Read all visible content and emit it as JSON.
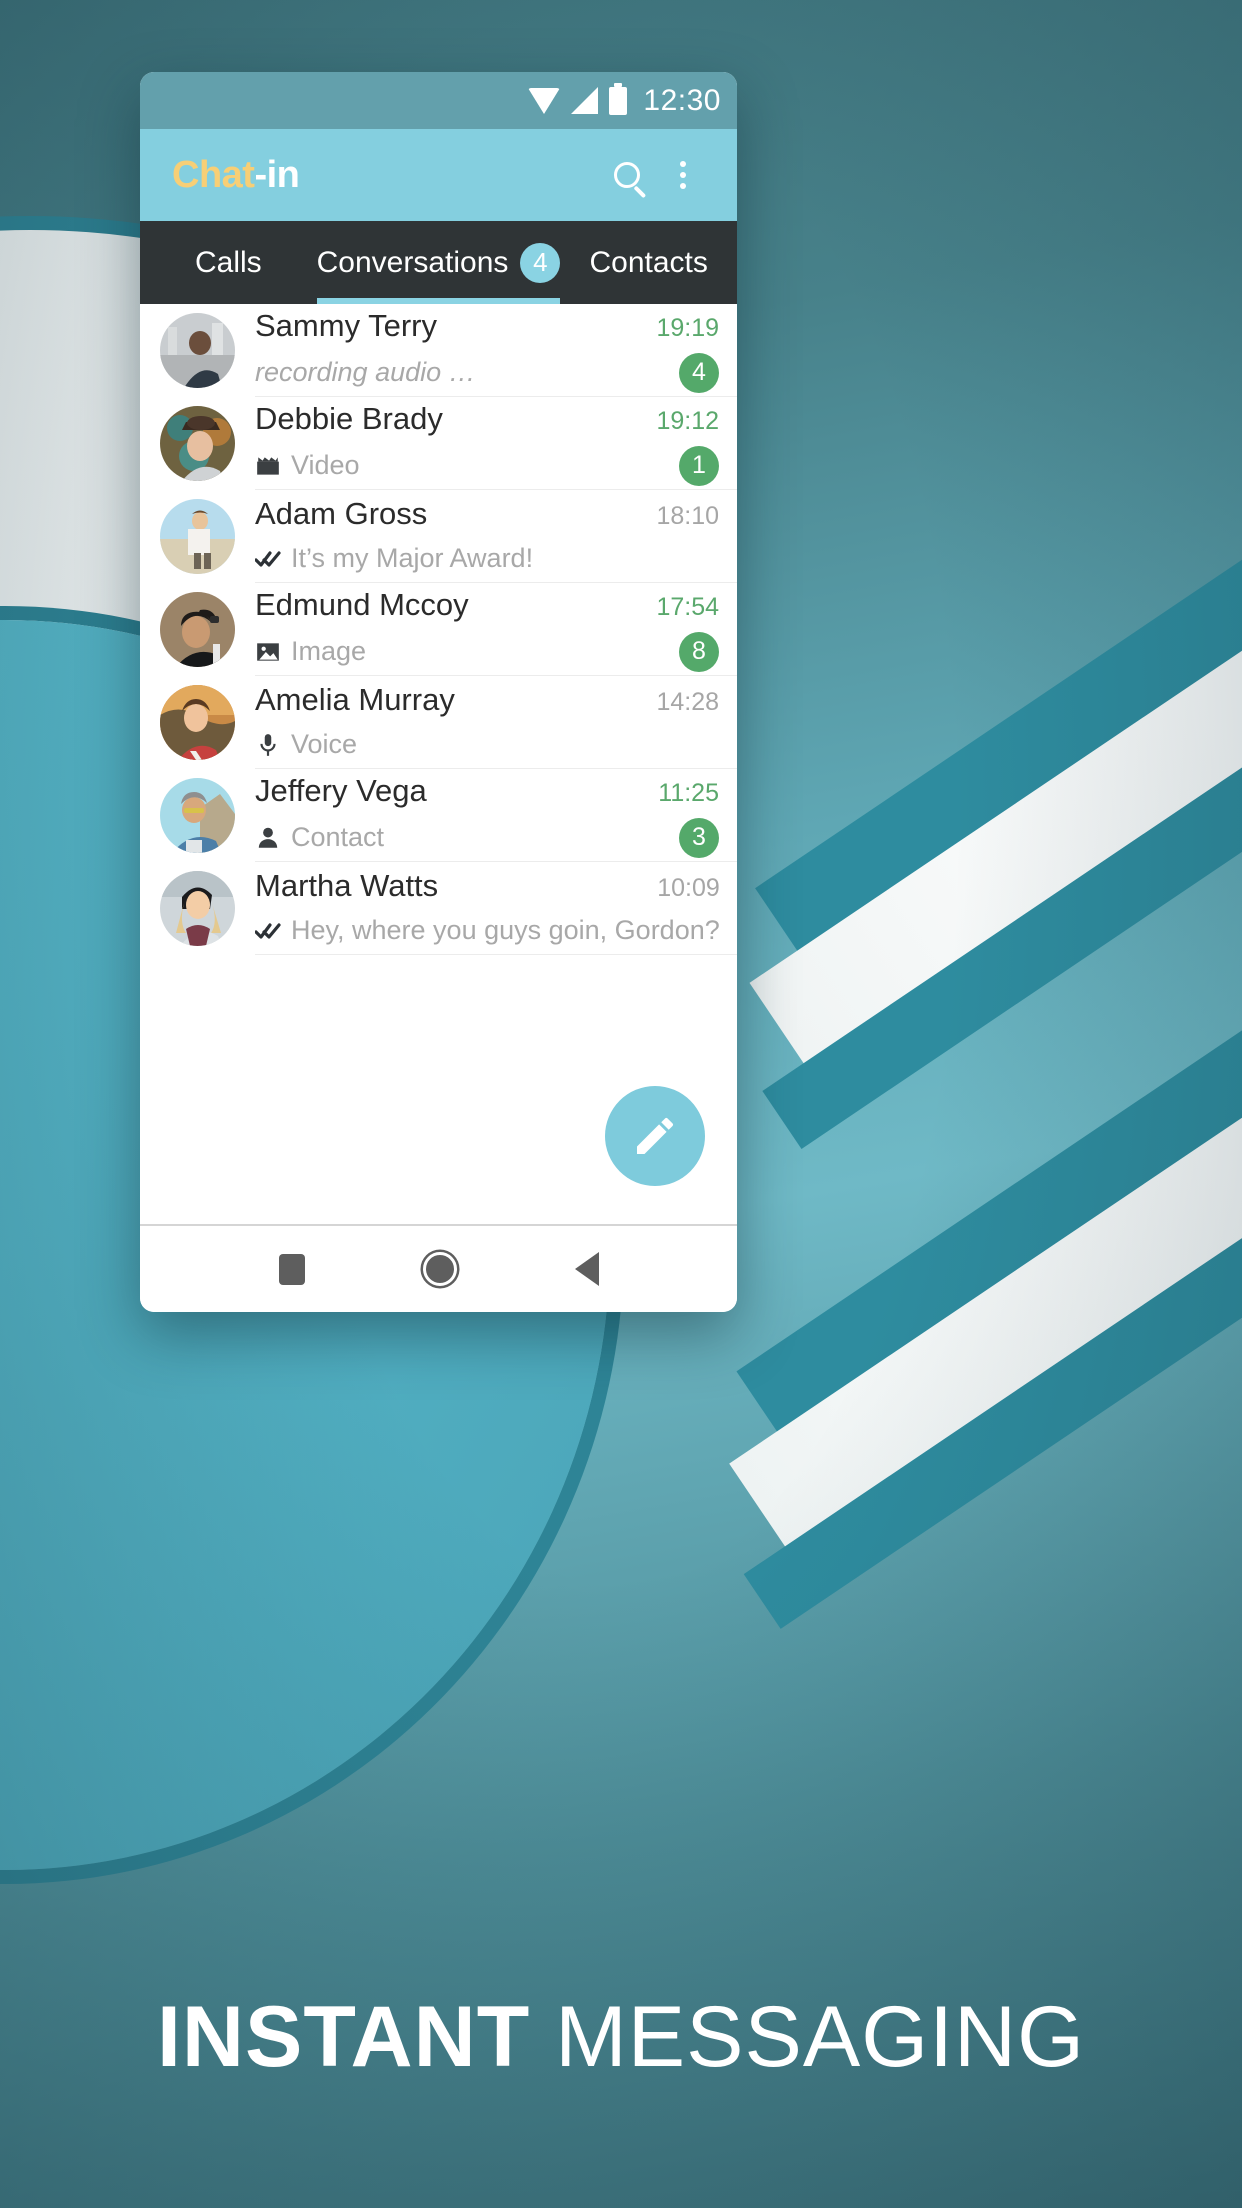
{
  "statusbar": {
    "time": "12:30",
    "icons": [
      "wifi-icon",
      "signal-icon",
      "battery-icon"
    ]
  },
  "appbar": {
    "brand_part1": "Chat",
    "brand_part2": "-in",
    "search_icon": "search-icon",
    "overflow_icon": "more-vertical-icon",
    "bg_color": "#84cfdf",
    "brand_accent_color": "#f7cf76"
  },
  "tabs": [
    {
      "label": "Calls",
      "badge": "",
      "active": false
    },
    {
      "label": "Conversations",
      "badge": "4",
      "active": true
    },
    {
      "label": "Contacts",
      "badge": "",
      "active": false
    }
  ],
  "tabbar": {
    "bg_color": "#2f3436",
    "indicator_color": "#8ad3e3",
    "badge_color": "#8ad3e3"
  },
  "conversations": [
    {
      "name": "Sammy Terry",
      "preview": "recording audio …",
      "preview_icon": "",
      "typing": true,
      "time": "19:19",
      "unread": "4",
      "time_state": "unread"
    },
    {
      "name": "Debbie Brady",
      "preview": "Video",
      "preview_icon": "video-clapperboard-icon",
      "typing": false,
      "time": "19:12",
      "unread": "1",
      "time_state": "unread"
    },
    {
      "name": "Adam Gross",
      "preview": "It’s my Major Award!",
      "preview_icon": "double-check-icon",
      "typing": false,
      "time": "18:10",
      "unread": "",
      "time_state": "read"
    },
    {
      "name": "Edmund Mccoy",
      "preview": "Image",
      "preview_icon": "image-icon",
      "typing": false,
      "time": "17:54",
      "unread": "8",
      "time_state": "unread"
    },
    {
      "name": "Amelia Murray",
      "preview": "Voice",
      "preview_icon": "microphone-icon",
      "typing": false,
      "time": "14:28",
      "unread": "",
      "time_state": "read"
    },
    {
      "name": "Jeffery Vega",
      "preview": "Contact",
      "preview_icon": "person-icon",
      "typing": false,
      "time": "11:25",
      "unread": "3",
      "time_state": "unread"
    },
    {
      "name": "Martha Watts",
      "preview": "Hey, where you guys goin, Gordon?",
      "preview_icon": "double-check-icon",
      "typing": false,
      "time": "10:09",
      "unread": "",
      "time_state": "read"
    }
  ],
  "fab": {
    "icon": "pencil-compose-icon",
    "color": "#7ecbdc"
  },
  "navbar": {
    "recents_icon": "square-recents-icon",
    "home_icon": "circle-home-icon",
    "back_icon": "triangle-back-icon"
  },
  "caption": {
    "strong": "INSTANT",
    "light": " MESSAGING"
  },
  "colors": {
    "unread_badge": "#54a96a",
    "unread_time": "#5aa86c",
    "read_time": "#a6a6a6",
    "preview_text": "#a8a8a8",
    "background_teal": "#4e8e99"
  }
}
